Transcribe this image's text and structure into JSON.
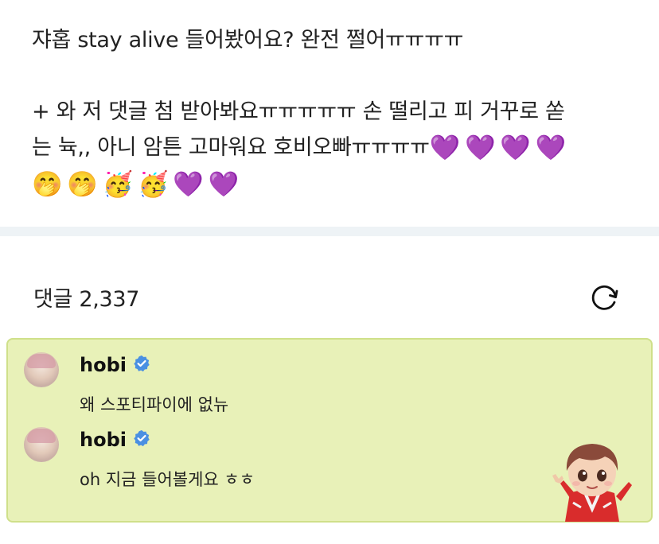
{
  "post": {
    "line1": "쟈홉 stay alive 들어봤어요? 완전 쩔어ㅠㅠㅠㅠ",
    "line2": "+ 와 저 댓글 첨 받아봐요ㅠㅠㅠㅠㅠ 손 떨리고 피 거꾸로 쏟",
    "line3_text": "는 뉵,, 아니 암튼 고마워요 호비오빠ㅠㅠㅠㅠ",
    "line3_emojis": [
      "💜",
      "💜",
      "💜",
      "💜"
    ],
    "line4_emojis": [
      "🤭",
      "🤭",
      "🥳",
      "🥳",
      "💜",
      "💜"
    ]
  },
  "comments_header": {
    "label": "댓글 2,337"
  },
  "refresh_icon": "refresh-icon",
  "comments": [
    {
      "username": "hobi",
      "verified": true,
      "text": "왜 스포티파이에 없뉴"
    },
    {
      "username": "hobi",
      "verified": true,
      "text": "oh 지금 들어볼게요 ㅎㅎ"
    }
  ],
  "colors": {
    "heart": "#9b3ff0",
    "comment_bg": "#e8f1b8",
    "comment_border": "#cfe08a",
    "verified": "#4a90e2",
    "divider": "#eef3f6"
  }
}
